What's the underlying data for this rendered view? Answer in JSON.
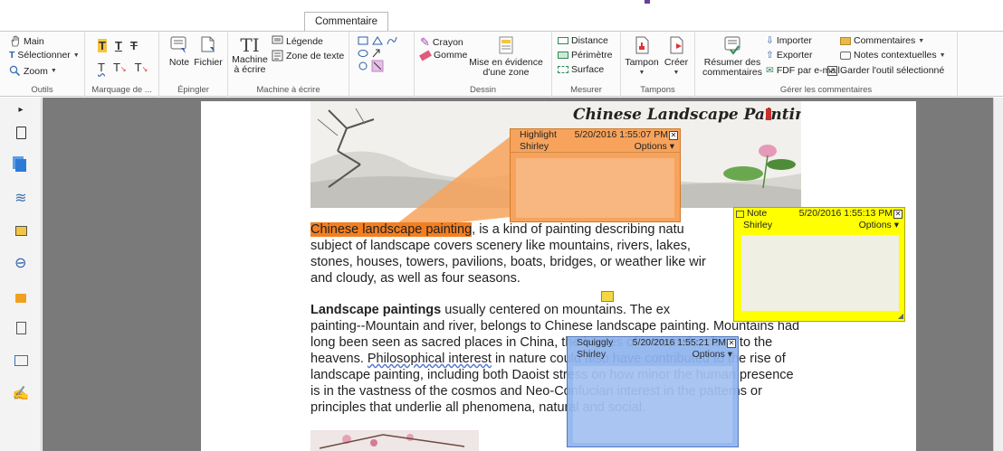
{
  "tab": {
    "label": "Commentaire"
  },
  "ribbon": {
    "outils": {
      "label": "Outils",
      "items": [
        "Main",
        "Sélectionner",
        "Zoom"
      ]
    },
    "marquage": {
      "label": "Marquage de ..."
    },
    "epingler": {
      "label": "Épingler",
      "note": "Note",
      "fichier": "Fichier"
    },
    "machine": {
      "label": "Machine à écrire",
      "btn_line1": "Machine",
      "btn_line2": "à écrire",
      "legende": "Légende",
      "zone_texte": "Zone de texte"
    },
    "dessin": {
      "label": "Dessin",
      "crayon": "Crayon",
      "gomme": "Gomme",
      "mise_line1": "Mise en évidence",
      "mise_line2": "d'une zone"
    },
    "mesurer": {
      "label": "Mesurer",
      "distance": "Distance",
      "perimetre": "Périmètre",
      "surface": "Surface"
    },
    "tampons": {
      "label": "Tampons",
      "tampon": "Tampon",
      "creer": "Créer"
    },
    "gerer": {
      "label": "Gérer les commentaires",
      "resumer_line1": "Résumer des",
      "resumer_line2": "commentaires",
      "importer": "Importer",
      "exporter": "Exporter",
      "fdf": "FDF par e-mail",
      "commentaires": "Commentaires",
      "notes_ctx": "Notes contextuelles",
      "garder": "Garder l'outil sélectionné"
    }
  },
  "document": {
    "title_art": "Chinese Landscape Painting",
    "p1": {
      "highlighted": "Chinese landscape painting",
      "l1_rest": ", is a kind of painting describing natu",
      "l2": "subject of landscape covers scenery like mountains, rivers, lakes,",
      "l3": "stones, houses, towers, pavilions, boats, bridges, or weather like wir",
      "l4": "and cloudy, as well as four seasons."
    },
    "p2": {
      "bold": "Landscape paintings",
      "l1_rest": " usually centered on mountains. The ex",
      "l2": "painting--Mountain and river, belongs to Chinese landscape painting. Mountains had",
      "l3": "long been seen as sacred places in China, the homes of immortals, close to the",
      "l4a": "heavens. ",
      "l4squig": "Philosophical interest",
      "l4b": " in nature could also have contributed to the rise of",
      "l5": "landscape painting, including both Daoist stress on how minor the human presence",
      "l6": "is in the vastness of the cosmos and Neo-Confucian interest in the patterns or",
      "l7": "principles that underlie all phenomena, natural and social."
    }
  },
  "popups": {
    "highlight": {
      "type": "Highlight",
      "date": "5/20/2016 1:55:07 PM",
      "author": "Shirley",
      "options": "Options"
    },
    "note": {
      "type": "Note",
      "date": "5/20/2016 1:55:13 PM",
      "author": "Shirley",
      "options": "Options"
    },
    "squiggly": {
      "type": "Squiggly",
      "date": "5/20/2016 1:55:21 PM",
      "author": "Shirley",
      "options": "Options"
    }
  },
  "colors": {
    "highlight": "#f47f20",
    "note": "#ffff00",
    "squiggly": "#8fb4ee",
    "accent": "#6b3fa0"
  }
}
